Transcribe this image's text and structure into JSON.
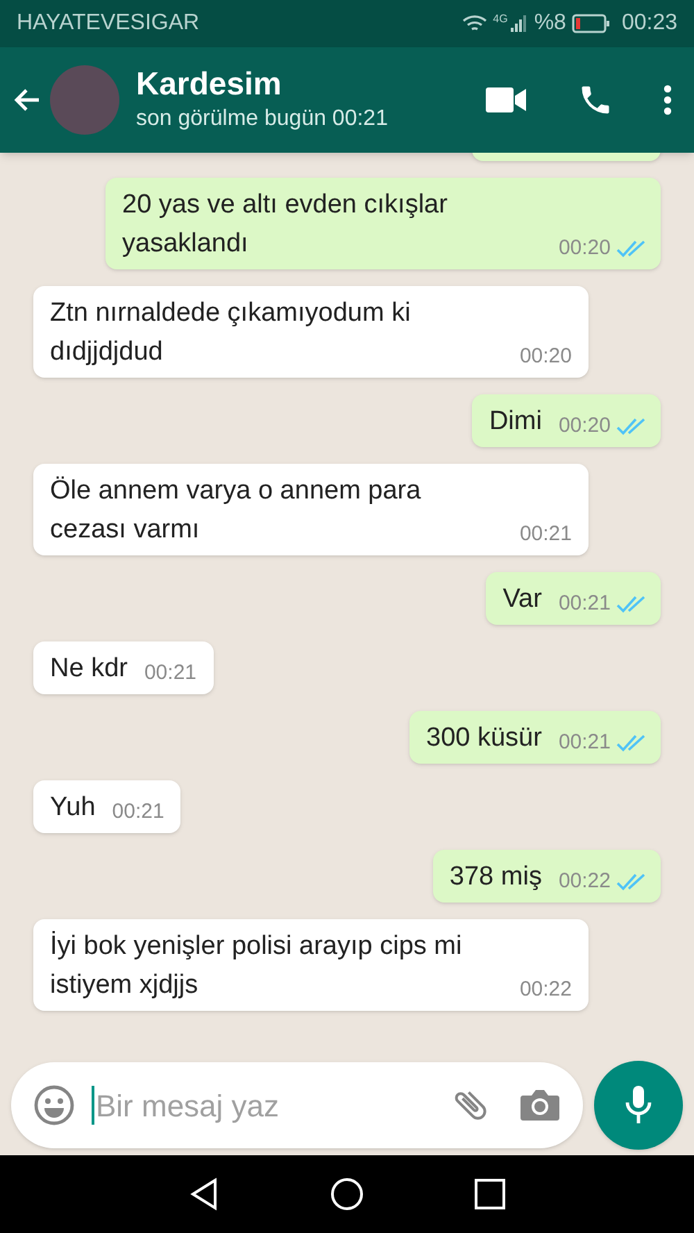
{
  "status_bar": {
    "carrier": "HAYATEVESIGAR",
    "network": "4G",
    "battery": "%8",
    "time": "00:23"
  },
  "header": {
    "name": "Kardesim",
    "last_seen": "son görülme bugün 00:21"
  },
  "messages": [
    {
      "kind": "out",
      "text": "20 yas ve altı evden cıkışlar yasaklandı",
      "time": "00:20",
      "read": true
    },
    {
      "kind": "in",
      "text": "Ztn nırnaldede çıkamıyodum ki dıdjjdjdud",
      "time": "00:20"
    },
    {
      "kind": "out",
      "text": "Dimi",
      "time": "00:20",
      "read": true
    },
    {
      "kind": "in",
      "text": "Öle annem varya o annem para cezası varmı",
      "time": "00:21"
    },
    {
      "kind": "out",
      "text": "Var",
      "time": "00:21",
      "read": true
    },
    {
      "kind": "in",
      "text": "Ne kdr",
      "time": "00:21"
    },
    {
      "kind": "out",
      "text": "300 küsür",
      "time": "00:21",
      "read": true
    },
    {
      "kind": "in",
      "text": "Yuh",
      "time": "00:21"
    },
    {
      "kind": "out",
      "text": "378 miş",
      "time": "00:22",
      "read": true
    },
    {
      "kind": "in",
      "text": "İyi bok yenişler polisi arayıp cips mi istiyem xjdjjs",
      "time": "00:22"
    }
  ],
  "composer": {
    "placeholder": "Bir mesaj yaz"
  }
}
